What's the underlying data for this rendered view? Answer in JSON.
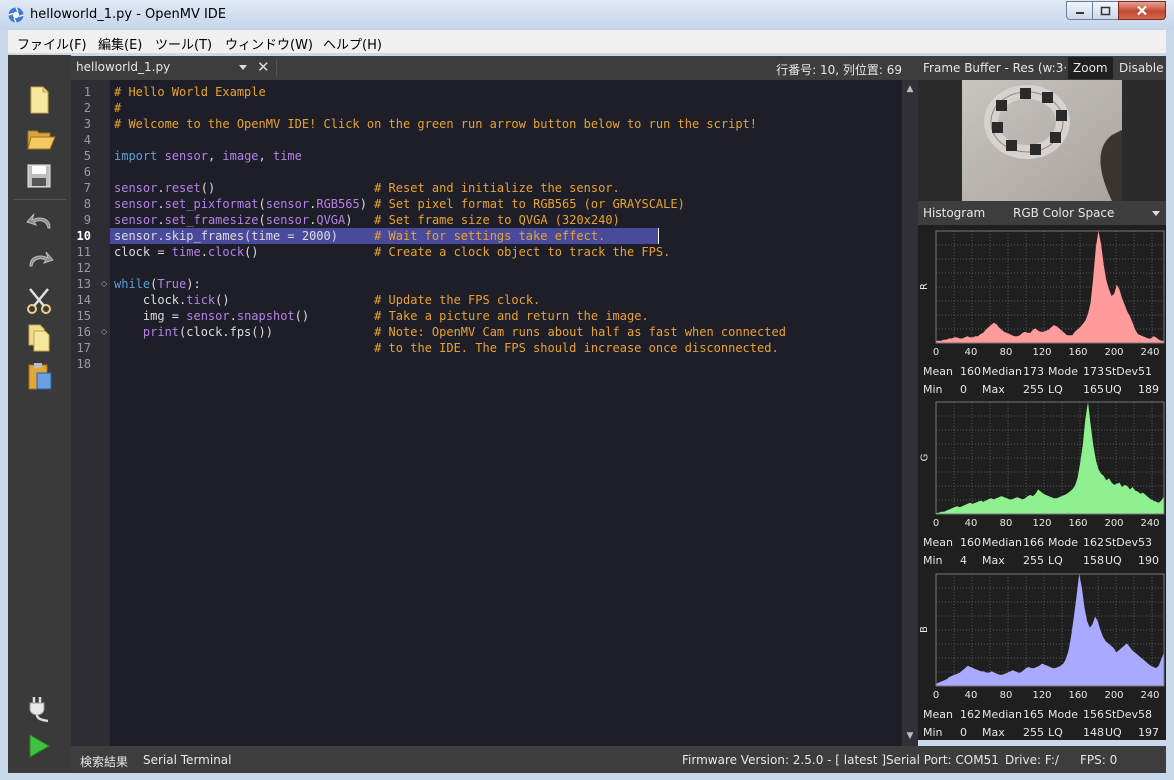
{
  "window": {
    "title": "helloworld_1.py - OpenMV IDE"
  },
  "menu": {
    "items": [
      "ファイル(F)",
      "編集(E)",
      "ツール(T)",
      "ウィンドウ(W)",
      "ヘルプ(H)"
    ]
  },
  "toolbar": {
    "icons": [
      "new-file-icon",
      "open-folder-icon",
      "save-icon",
      "undo-icon",
      "redo-icon",
      "cut-icon",
      "copy-icon",
      "paste-icon",
      "connect-plug-icon",
      "run-icon"
    ]
  },
  "editor": {
    "file_name": "helloworld_1.py",
    "cursor_position": "行番号: 10, 列位置: 69",
    "current_line": 10,
    "fold_markers": [
      13,
      16
    ],
    "line_numbers": [
      "1",
      "2",
      "3",
      "4",
      "5",
      "6",
      "7",
      "8",
      "9",
      "10",
      "11",
      "12",
      "13",
      "14",
      "15",
      "16",
      "17",
      "18"
    ],
    "lines": [
      [
        [
          "cm",
          "# Hello World Example"
        ]
      ],
      [
        [
          "cm",
          "#"
        ]
      ],
      [
        [
          "cm",
          "# Welcome to the OpenMV IDE! Click on the green run arrow button below to run the script!"
        ]
      ],
      [],
      [
        [
          "kw",
          "import "
        ],
        [
          "fn",
          "sensor"
        ],
        [
          "",
          ", "
        ],
        [
          "fn",
          "image"
        ],
        [
          "",
          ", "
        ],
        [
          "fn",
          "time"
        ]
      ],
      [],
      [
        [
          "fn",
          "sensor"
        ],
        [
          "",
          "."
        ],
        [
          "fn",
          "reset"
        ],
        [
          "",
          "()                      "
        ],
        [
          "cm",
          "# Reset and initialize the sensor."
        ]
      ],
      [
        [
          "fn",
          "sensor"
        ],
        [
          "",
          "."
        ],
        [
          "fn",
          "set_pixformat"
        ],
        [
          "",
          "("
        ],
        [
          "fn",
          "sensor"
        ],
        [
          "",
          "."
        ],
        [
          "fn",
          "RGB565"
        ],
        [
          "",
          ") "
        ],
        [
          "cm",
          "# Set pixel format to RGB565 (or GRAYSCALE)"
        ]
      ],
      [
        [
          "fn",
          "sensor"
        ],
        [
          "",
          "."
        ],
        [
          "fn",
          "set_framesize"
        ],
        [
          "",
          "("
        ],
        [
          "fn",
          "sensor"
        ],
        [
          "",
          "."
        ],
        [
          "fn",
          "QVGA"
        ],
        [
          "",
          ")   "
        ],
        [
          "cm",
          "# Set frame size to QVGA (320x240)"
        ]
      ],
      [
        [
          "",
          "sensor.skip_frames(time = 2000)     "
        ],
        [
          "cm",
          "# Wait for settings take effect."
        ]
      ],
      [
        [
          "",
          "clock = "
        ],
        [
          "fn",
          "time"
        ],
        [
          "",
          "."
        ],
        [
          "fn",
          "clock"
        ],
        [
          "",
          "()                "
        ],
        [
          "cm",
          "# Create a clock object to track the FPS."
        ]
      ],
      [],
      [
        [
          "kw",
          "while"
        ],
        [
          "",
          "("
        ],
        [
          "fn",
          "True"
        ],
        [
          "",
          "):"
        ]
      ],
      [
        [
          "",
          "    clock."
        ],
        [
          "fn",
          "tick"
        ],
        [
          "",
          "()                    "
        ],
        [
          "cm",
          "# Update the FPS clock."
        ]
      ],
      [
        [
          "",
          "    img = "
        ],
        [
          "fn",
          "sensor"
        ],
        [
          "",
          "."
        ],
        [
          "fn",
          "snapshot"
        ],
        [
          "",
          "()         "
        ],
        [
          "cm",
          "# Take a picture and return the image."
        ]
      ],
      [
        [
          "",
          "    "
        ],
        [
          "fn",
          "print"
        ],
        [
          "",
          "(clock.fps())              "
        ],
        [
          "cm",
          "# Note: OpenMV Cam runs about half as fast when connected"
        ]
      ],
      [
        [
          "",
          "                                    "
        ],
        [
          "cm",
          "# to the IDE. The FPS should increase once disconnected."
        ]
      ],
      []
    ]
  },
  "frame_buffer": {
    "title": "Frame Buffer - Res (w:3···",
    "zoom_label": "Zoom",
    "disable_label": "Disable"
  },
  "histogram": {
    "label": "Histogram",
    "color_space": "RGB Color Space",
    "ticks": [
      "0",
      "40",
      "80",
      "120",
      "160",
      "200",
      "240"
    ],
    "channels": [
      {
        "name": "R",
        "color": "#ff9b9b",
        "curve": [
          2,
          2,
          2,
          3,
          3,
          4,
          4,
          5,
          5,
          4,
          4,
          5,
          6,
          5,
          5,
          6,
          6,
          8,
          9,
          12,
          14,
          16,
          18,
          17,
          14,
          12,
          10,
          9,
          8,
          7,
          6,
          6,
          7,
          9,
          10,
          9,
          9,
          12,
          13,
          11,
          10,
          10,
          11,
          12,
          14,
          16,
          15,
          13,
          11,
          9,
          7,
          7,
          7,
          10,
          12,
          14,
          17,
          20,
          26,
          36,
          58,
          86,
          100,
          88,
          70,
          56,
          48,
          42,
          44,
          52,
          48,
          40,
          34,
          28,
          24,
          18,
          12,
          8,
          7,
          6,
          5,
          4,
          4,
          6,
          5,
          3,
          2,
          2
        ],
        "stats": {
          "mean": "160",
          "median": "173",
          "mode": "173",
          "stdev": "51",
          "min": "0",
          "max": "255",
          "lq": "165",
          "uq": "189"
        }
      },
      {
        "name": "G",
        "color": "#8ff08f",
        "curve": [
          1,
          1,
          2,
          2,
          3,
          4,
          5,
          6,
          7,
          6,
          7,
          8,
          9,
          10,
          9,
          10,
          11,
          12,
          11,
          12,
          13,
          14,
          13,
          14,
          15,
          16,
          15,
          14,
          13,
          13,
          14,
          15,
          14,
          13,
          14,
          16,
          17,
          16,
          18,
          22,
          20,
          18,
          17,
          16,
          15,
          14,
          14,
          15,
          16,
          17,
          18,
          20,
          22,
          25,
          32,
          45,
          62,
          85,
          100,
          80,
          62,
          48,
          40,
          36,
          34,
          30,
          32,
          28,
          26,
          27,
          28,
          24,
          26,
          25,
          22,
          24,
          21,
          20,
          18,
          19,
          17,
          15,
          13,
          12,
          11,
          10,
          12,
          16
        ],
        "stats": {
          "mean": "160",
          "median": "166",
          "mode": "162",
          "stdev": "53",
          "min": "4",
          "max": "255",
          "lq": "158",
          "uq": "190"
        }
      },
      {
        "name": "B",
        "color": "#a9a9ff",
        "curve": [
          2,
          3,
          4,
          5,
          6,
          8,
          9,
          10,
          11,
          12,
          14,
          16,
          18,
          17,
          16,
          15,
          14,
          13,
          13,
          12,
          12,
          13,
          12,
          11,
          10,
          10,
          11,
          12,
          13,
          14,
          13,
          12,
          12,
          14,
          16,
          17,
          16,
          16,
          17,
          18,
          20,
          19,
          18,
          17,
          16,
          16,
          17,
          18,
          20,
          24,
          32,
          45,
          62,
          80,
          100,
          88,
          70,
          58,
          52,
          55,
          62,
          58,
          50,
          44,
          40,
          38,
          36,
          34,
          30,
          32,
          34,
          36,
          38,
          35,
          32,
          30,
          28,
          26,
          24,
          22,
          20,
          18,
          17,
          16,
          18,
          24,
          30
        ],
        "stats": {
          "mean": "162",
          "median": "165",
          "mode": "156",
          "stdev": "58",
          "min": "0",
          "max": "255",
          "lq": "148",
          "uq": "197"
        }
      }
    ],
    "stat_labels": {
      "mean": "Mean",
      "median": "Median",
      "mode": "Mode",
      "stdev": "StDev",
      "min": "Min",
      "max": "Max",
      "lq": "LQ",
      "uq": "UQ"
    }
  },
  "statusbar": {
    "search_results": "検索結果",
    "serial_terminal": "Serial Terminal",
    "firmware": "Firmware Version: 2.5.0 - [ latest ]",
    "serial_port": "Serial Port: COM51",
    "drive": "Drive: F:/",
    "fps": "FPS: 0"
  }
}
